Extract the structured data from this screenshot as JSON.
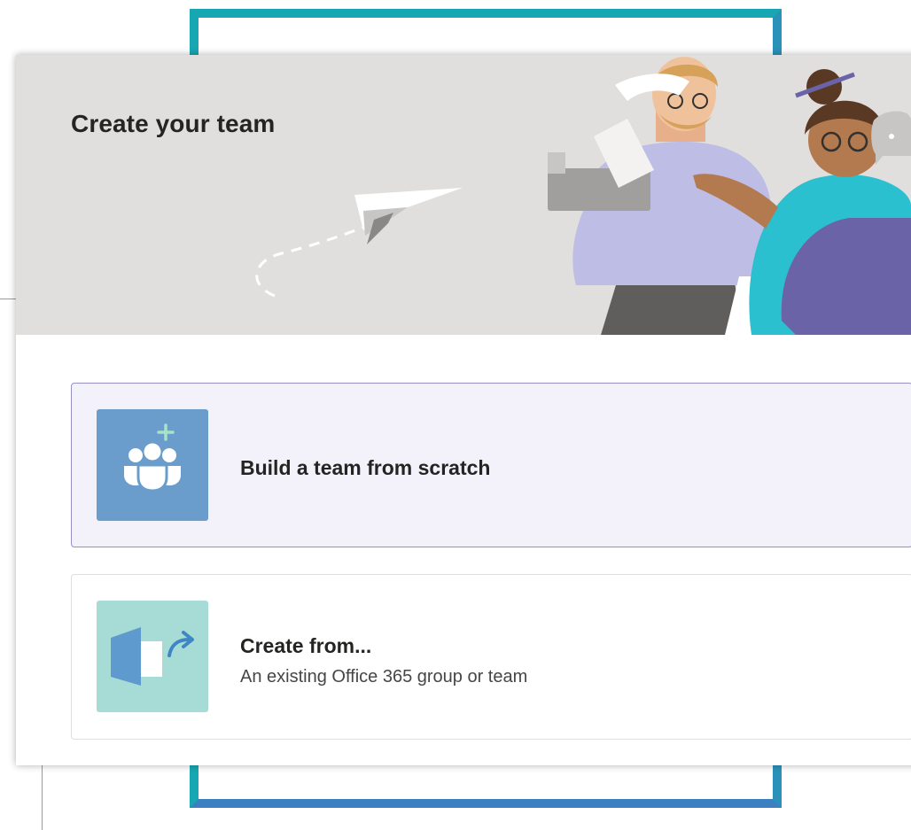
{
  "dialog": {
    "title": "Create your team"
  },
  "options": [
    {
      "title": "Build a team from scratch",
      "subtitle": "",
      "icon": "team-add-icon",
      "tile_color": "#6a9ccc",
      "selected": true
    },
    {
      "title": "Create from...",
      "subtitle": "An existing Office 365 group or team",
      "icon": "existing-group-icon",
      "tile_color": "#a7dbd5",
      "selected": false
    }
  ],
  "colors": {
    "header_bg": "#e1dfdd",
    "frame_teal": "#17a7b2",
    "selected_option_bg": "#f3f2fa",
    "selected_option_border": "#9591c6"
  }
}
